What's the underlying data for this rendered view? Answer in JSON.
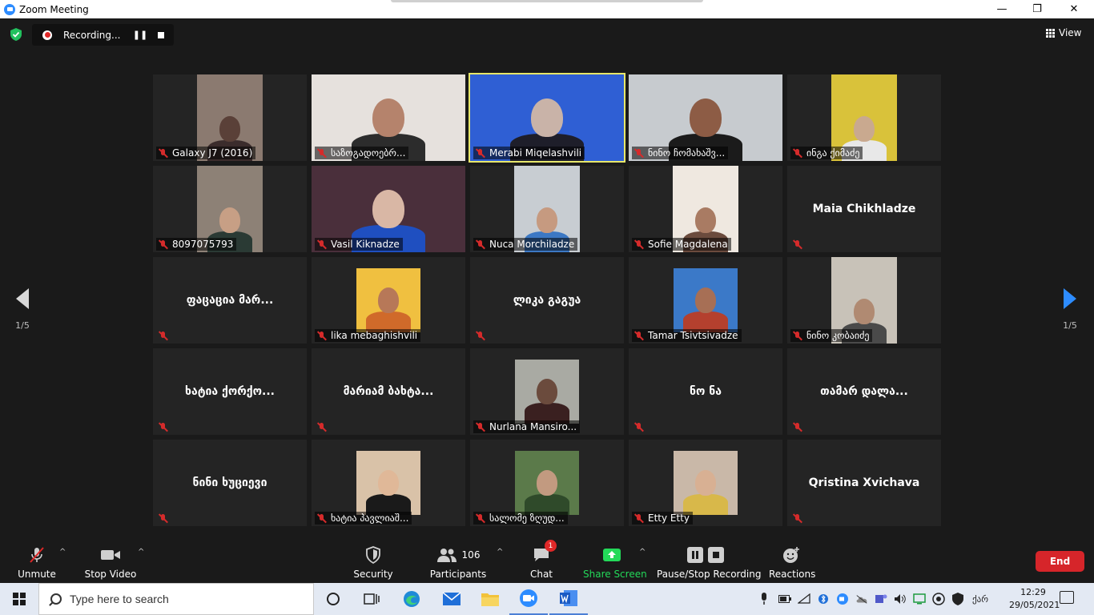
{
  "window": {
    "title": "Zoom Meeting",
    "minimize": "—",
    "maximize": "❐",
    "close": "✕"
  },
  "recording": {
    "label": "Recording...",
    "pause_glyph": "❚❚"
  },
  "view": {
    "label": "View"
  },
  "pagination": {
    "left": "1/5",
    "right": "1/5"
  },
  "participants": [
    {
      "name": "Galaxy J7 (2016)",
      "video": true,
      "style": "portrait",
      "bg": "#8b7a70",
      "face": "#5a4038",
      "body": "#3b2c2c"
    },
    {
      "name": "საზოგადოებრ...",
      "video": true,
      "style": "full",
      "bg": "#e6e1dd",
      "face": "#b5836c",
      "body": "#2c2c2c"
    },
    {
      "name": "Merabi Miqelashvili",
      "video": true,
      "style": "full",
      "bg": "#2f5fd4",
      "face": "#c9b3a8",
      "body": "#1e1e2a",
      "active": true
    },
    {
      "name": "ნინო ჩომახაშვ...",
      "video": true,
      "style": "full",
      "bg": "#c7cbcf",
      "face": "#8d5c45",
      "body": "#1b1b1b"
    },
    {
      "name": "ინგა ქიმაძე",
      "video": true,
      "style": "portrait",
      "bg": "#d9c23a",
      "face": "#c9a98f",
      "body": "#e8e8e8"
    },
    {
      "name": "8097075793",
      "video": true,
      "style": "portrait",
      "bg": "#8d8176",
      "face": "#c79f85",
      "body": "#2a3a34"
    },
    {
      "name": "Vasil Kiknadze",
      "video": true,
      "style": "full",
      "bg": "#4a2f3b",
      "face": "#d9b7a5",
      "body": "#1f4fc0"
    },
    {
      "name": "Nuca Morchiladze",
      "video": true,
      "style": "portrait",
      "bg": "#c8cdd2",
      "face": "#c69a80",
      "body": "#3c78c4"
    },
    {
      "name": "Sofie Magdalena",
      "video": true,
      "style": "portrait",
      "bg": "#efe8e0",
      "face": "#a97b63",
      "body": "#6b4b3d"
    },
    {
      "name": "Maia Chikhladze",
      "video": false
    },
    {
      "name": "ფაცაცია მარ...",
      "video": false
    },
    {
      "name": "lika mebaghishvili",
      "video": true,
      "style": "small",
      "bg": "#f0c040",
      "face": "#b77858",
      "body": "#d06a2a"
    },
    {
      "name": "ლიკა გაგუა",
      "video": false
    },
    {
      "name": "Tamar Tsivtsivadze",
      "video": true,
      "style": "small",
      "bg": "#3b79c8",
      "face": "#a76f55",
      "body": "#b4402e"
    },
    {
      "name": "ნინო კობაიძე",
      "video": true,
      "style": "portrait",
      "bg": "#c8c2b8",
      "face": "#b08a72",
      "body": "#4a4a4a"
    },
    {
      "name": "ხატია ქორქო...",
      "video": false
    },
    {
      "name": "მარიამ ბახტა...",
      "video": false
    },
    {
      "name": "Nurlana Mansiro...",
      "video": true,
      "style": "small",
      "bg": "#a9aaa3",
      "face": "#6b4b3d",
      "body": "#3a2020"
    },
    {
      "name": "ნო ნა",
      "video": false
    },
    {
      "name": "თამარ დალა...",
      "video": false
    },
    {
      "name": "ნინი ხუციევი",
      "video": false
    },
    {
      "name": "ხატია პავლიაშ...",
      "video": true,
      "style": "small",
      "bg": "#d9c2a8",
      "face": "#e0b898",
      "body": "#1a1a1a"
    },
    {
      "name": "სალომე ზღუდ...",
      "video": true,
      "style": "small",
      "bg": "#5b7a4a",
      "face": "#c29a80",
      "body": "#2f4a2a"
    },
    {
      "name": "Etty Etty",
      "video": true,
      "style": "small",
      "bg": "#c9b8a8",
      "face": "#d8b093",
      "body": "#d8b84a"
    },
    {
      "name": "Qristina Xvichava",
      "video": false
    }
  ],
  "toolbar": {
    "unmute": "Unmute",
    "stop_video": "Stop Video",
    "security": "Security",
    "participants": "Participants",
    "participants_count": "106",
    "chat": "Chat",
    "chat_badge": "1",
    "share_screen": "Share Screen",
    "pause_stop_recording": "Pause/Stop Recording",
    "reactions": "Reactions",
    "end": "End",
    "share_color": "#23d959"
  },
  "taskbar": {
    "search_placeholder": "Type here to search",
    "language": "ქარ",
    "time": "12:29",
    "date": "29/05/2021"
  }
}
